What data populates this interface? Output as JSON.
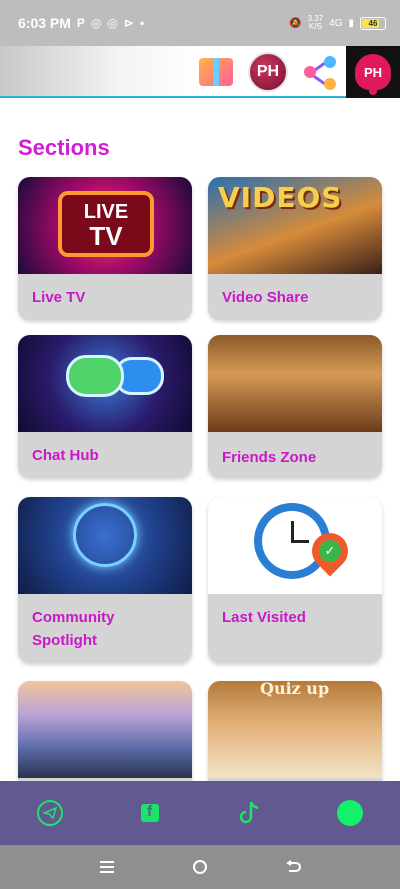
{
  "status_bar": {
    "time": "6:03 PM",
    "speed_value": "3.37",
    "speed_unit": "K/S",
    "network": "4G",
    "battery": "46"
  },
  "header": {
    "icons": [
      "gift-box-icon",
      "ph-logo",
      "share-nodes-icon",
      "notification-bell-icon"
    ],
    "logo_text": "PH",
    "bell_text": "PH"
  },
  "sections": {
    "title": "Sections",
    "cards": [
      {
        "label": "Live TV",
        "thumb_icon": "live-tv-image",
        "thumb_text_1": "LIVE",
        "thumb_text_2": "TV"
      },
      {
        "label": "Video Share",
        "thumb_icon": "video-collage-image",
        "thumb_text_1": "VIDEOS"
      },
      {
        "label": "Chat Hub",
        "thumb_icon": "chat-bubbles-image"
      },
      {
        "label": "Friends Zone",
        "thumb_icon": "cafe-crowd-image"
      },
      {
        "label": "Community Spotlight",
        "thumb_icon": "community-hologram-image"
      },
      {
        "label": "Last Visited",
        "thumb_icon": "clock-location-image"
      },
      {
        "label": "",
        "thumb_icon": "fantasy-castle-image"
      },
      {
        "label": "",
        "thumb_icon": "quiz-study-image",
        "thumb_text_1": "Quiz up"
      }
    ]
  },
  "bottom_nav": {
    "items": [
      "telegram-icon",
      "facebook-icon",
      "tiktok-icon",
      "status-dot-icon"
    ],
    "accent_color": "#1de36a",
    "background_color": "#605a90"
  },
  "system_nav": {
    "items": [
      "menu-icon",
      "home-icon",
      "back-icon"
    ]
  },
  "colors": {
    "section_title": "#d21fd6",
    "card_label": "#c819c8",
    "card_background": "#d4d4d4",
    "header_underline": "#2bb3d8"
  }
}
